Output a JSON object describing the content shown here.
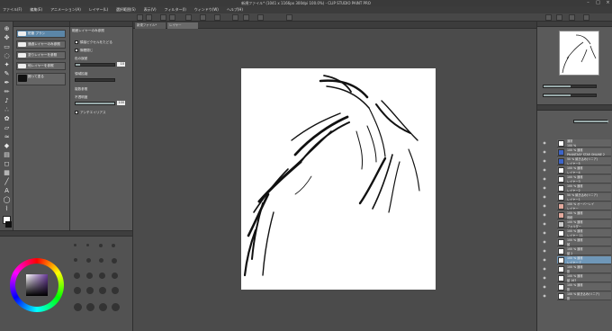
{
  "window": {
    "title": "新規ファイル* (1041 x 1166px 300dpi 100.0%) - CLIP STUDIO PAINT PRO"
  },
  "menu": [
    "ファイル(F)",
    "編集(E)",
    "アニメーション(A)",
    "レイヤー(L)",
    "選択範囲(S)",
    "表示(V)",
    "フィルター(I)",
    "ウィンドウ(W)",
    "ヘルプ(H)"
  ],
  "subtool": {
    "items": [
      "鉛筆 ブラシ",
      "通過レイヤーのみ参照",
      "塗りレイヤーを参照",
      "他レイヤーを参照",
      "囲って塗る"
    ],
    "selected": 0
  },
  "tool_property": {
    "title": "範囲レイヤーのみ参照",
    "options": [
      {
        "label": "隣接ピクセルをたどる",
        "checked": true
      },
      {
        "label": "隙間閉じ",
        "checked": true
      },
      {
        "label": "色の誤差",
        "checked": false,
        "value": "10"
      },
      {
        "label": "領域拡縮",
        "checked": false
      },
      {
        "label": "複数参照",
        "checked": false
      },
      {
        "label": "不透明度",
        "checked": false,
        "value": "100"
      },
      {
        "label": "アンチエイリアス",
        "checked": true
      }
    ]
  },
  "document": {
    "tabs": [
      "新規ファイル*",
      "レイヤー"
    ]
  },
  "layers": [
    {
      "label": "通常\n100 %",
      "thumb": "white"
    },
    {
      "label": "100 % 通常\nPHANTASY STAR ONLINE 2",
      "thumb": "blue"
    },
    {
      "label": "50 % 焼き込み(リニア)\nレイヤー5",
      "thumb": "blue"
    },
    {
      "label": "100 % 通常\nレイヤー4",
      "thumb": "white"
    },
    {
      "label": "100 % 通常\nレイヤー3",
      "thumb": "white"
    },
    {
      "label": "100 % 通常\nレイヤー2",
      "thumb": "white"
    },
    {
      "label": "50 % 焼き込み(リニア)\nレイヤー1",
      "thumb": "white"
    },
    {
      "label": "100 % オーバーレイ\nレイヤー",
      "thumb": "red"
    },
    {
      "label": "100 % 通常\n用紙",
      "thumb": "red"
    },
    {
      "label": "100 % 通常\nフォルダー",
      "thumb": "folder"
    },
    {
      "label": "100 % 通常\nレイヤー 11",
      "thumb": "white"
    },
    {
      "label": "100 % 通常\n顔",
      "thumb": "white"
    },
    {
      "label": "100 % 通常\n髪 2",
      "thumb": "white"
    },
    {
      "label": "100 % 通常\nレイヤー 7",
      "thumb": "white"
    },
    {
      "label": "100 % 通常\n影",
      "thumb": "white"
    },
    {
      "label": "100 % 通常\n髪 167",
      "thumb": "white"
    },
    {
      "label": "100 % 通常\n影",
      "thumb": "white"
    },
    {
      "label": "100 % 焼き込み(リニア)\n影",
      "thumb": "white"
    }
  ],
  "selected_layer": 13,
  "colors": {
    "accent": "#5b86a8"
  }
}
